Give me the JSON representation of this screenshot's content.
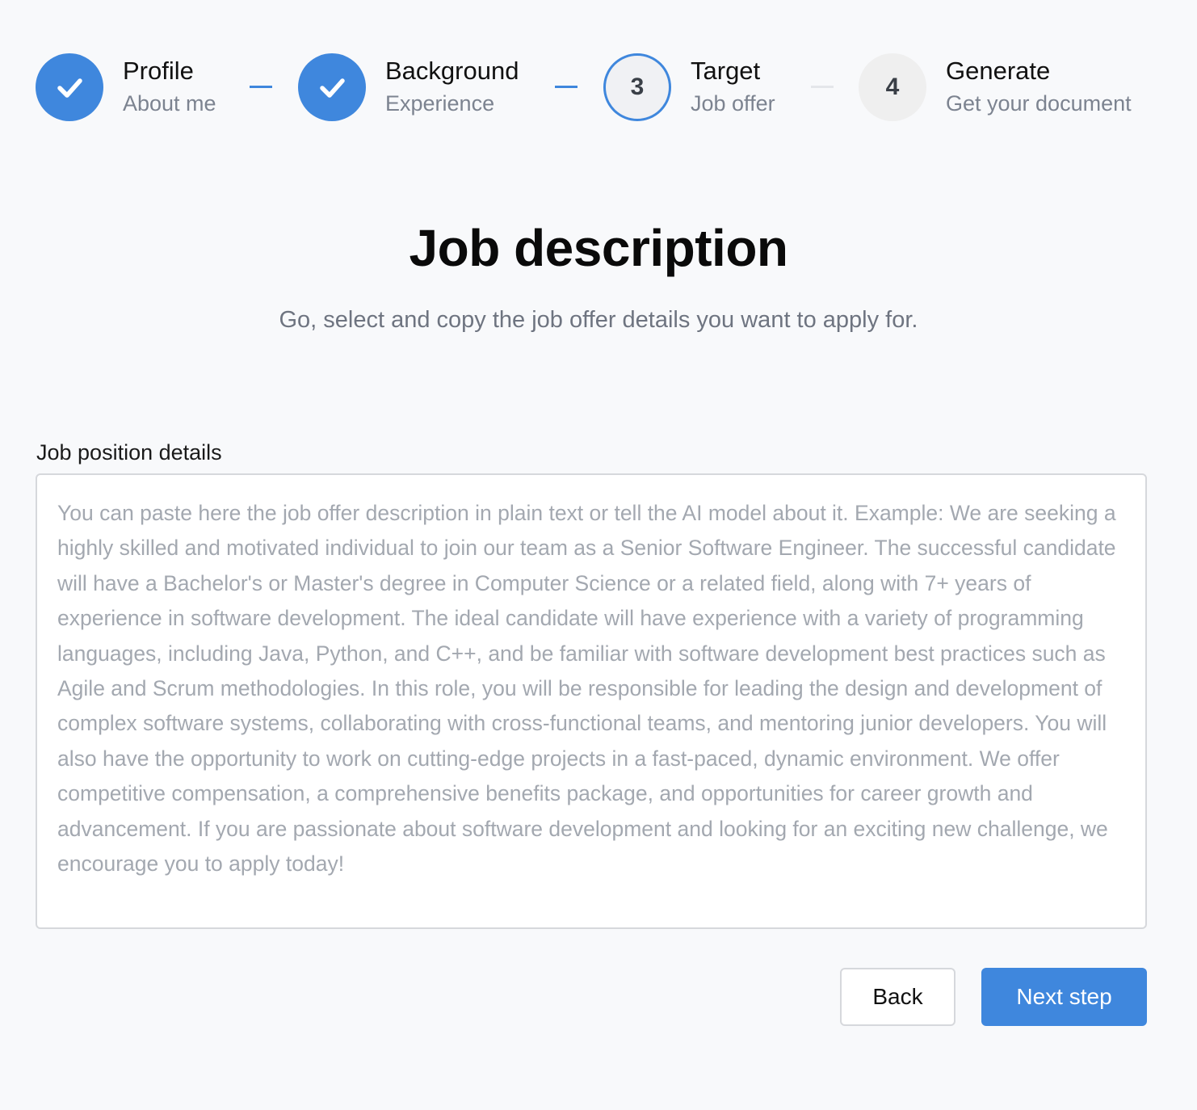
{
  "stepper": {
    "steps": [
      {
        "number": "1",
        "title": "Profile",
        "subtitle": "About me",
        "status": "completed",
        "icon": "check-icon"
      },
      {
        "number": "2",
        "title": "Background",
        "subtitle": "Experience",
        "status": "completed",
        "icon": "check-icon"
      },
      {
        "number": "3",
        "title": "Target",
        "subtitle": "Job offer",
        "status": "current"
      },
      {
        "number": "4",
        "title": "Generate",
        "subtitle": "Get your document",
        "status": "pending"
      }
    ]
  },
  "main": {
    "title": "Job description",
    "subtitle": "Go, select and copy the job offer details you want to apply for."
  },
  "form": {
    "label": "Job position details",
    "value": "",
    "placeholder": "You can paste here the job offer description in plain text or tell the AI model about it. Example: We are seeking a highly skilled and motivated individual to join our team as a Senior Software Engineer. The successful candidate will have a Bachelor's or Master's degree in Computer Science or a related field, along with 7+ years of experience in software development. The ideal candidate will have experience with a variety of programming languages, including Java, Python, and C++, and be familiar with software development best practices such as Agile and Scrum methodologies. In this role, you will be responsible for leading the design and development of complex software systems, collaborating with cross-functional teams, and mentoring junior developers. You will also have the opportunity to work on cutting-edge projects in a fast-paced, dynamic environment. We offer competitive compensation, a comprehensive benefits package, and opportunities for career growth and advancement. If you are passionate about software development and looking for an exciting new challenge, we encourage you to apply today!"
  },
  "actions": {
    "back_label": "Back",
    "next_label": "Next step"
  },
  "colors": {
    "accent": "#3f87dd",
    "background": "#f8f9fb",
    "muted_text": "#7c8390",
    "placeholder": "#a3a8b0"
  }
}
